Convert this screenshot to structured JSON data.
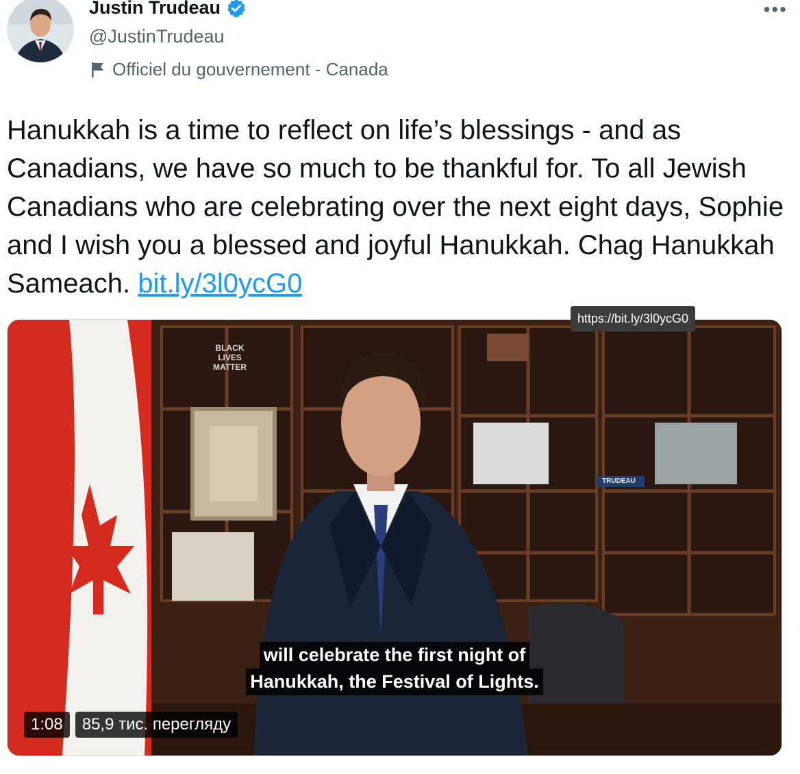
{
  "author": {
    "display_name": "Justin Trudeau",
    "handle": "@JustinTrudeau",
    "label": "Officiel du gouvernement - Canada"
  },
  "menu": {
    "more_label": "•••"
  },
  "tweet": {
    "text": "Hanukkah is a time to reflect on life’s blessings - and as Canadians, we have so much to be thankful for. To all Jewish Canadians who are celebrating over the next eight days, Sophie and I wish you a blessed and joyful Hanukkah. Chag Hanukkah Sameach. ",
    "link_text": "bit.ly/3l0ycG0",
    "link_tooltip": "https://bit.ly/3l0ycG0"
  },
  "video": {
    "caption_line1": "will celebrate the first night of",
    "caption_line2": "Hanukkah, the Festival of Lights.",
    "duration": "1:08",
    "views": "85,9 тис. перегляду",
    "scene_texts": {
      "sign": [
        "BLACK",
        "LIVES",
        "MATTER"
      ],
      "nameplate": "TRUDEAU"
    }
  },
  "icons": {
    "verified": "verified-badge-icon",
    "government_label": "flag-icon",
    "more": "more-options-icon"
  },
  "colors": {
    "link": "#1d9bf0",
    "verified": "#1d9bf0",
    "secondary_text": "#536471",
    "canada_red": "#d52b1e"
  }
}
